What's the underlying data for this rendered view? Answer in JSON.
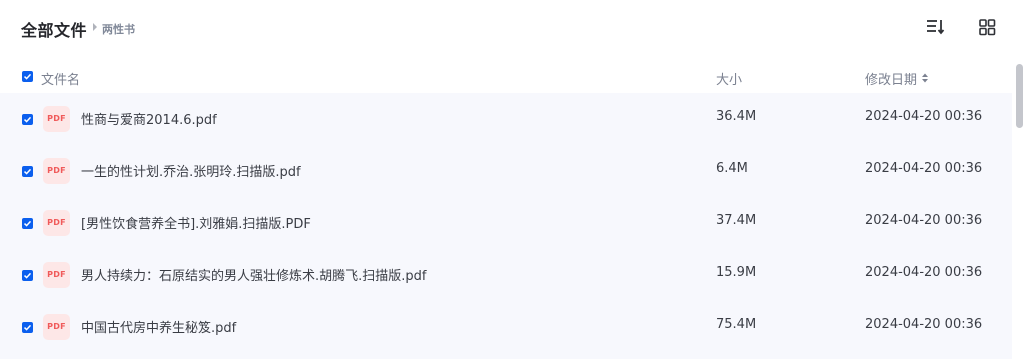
{
  "header": {
    "title": "全部文件",
    "breadcrumb": "两性书"
  },
  "toolbar": {
    "sort_icon": "sort-list-icon",
    "view_icon": "grid-view-icon"
  },
  "columns": {
    "name": "文件名",
    "size": "大小",
    "modified": "修改日期"
  },
  "files": [
    {
      "icon_label": "PDF",
      "name": "性商与爱商2014.6.pdf",
      "size": "36.4M",
      "modified": "2024-04-20 00:36",
      "checked": true
    },
    {
      "icon_label": "PDF",
      "name": "一生的性计划.乔治.张明玲.扫描版.pdf",
      "size": "6.4M",
      "modified": "2024-04-20 00:36",
      "checked": true
    },
    {
      "icon_label": "PDF",
      "name": "[男性饮食营养全书].刘雅娟.扫描版.PDF",
      "size": "37.4M",
      "modified": "2024-04-20 00:36",
      "checked": true
    },
    {
      "icon_label": "PDF",
      "name": "男人持续力：石原结实的男人强壮修炼术.胡腾飞.扫描版.pdf",
      "size": "15.9M",
      "modified": "2024-04-20 00:36",
      "checked": true
    },
    {
      "icon_label": "PDF",
      "name": "中国古代房中养生秘笈.pdf",
      "size": "75.4M",
      "modified": "2024-04-20 00:36",
      "checked": true
    }
  ],
  "colors": {
    "accent": "#0b5fee",
    "row_background": "#f7f8fd",
    "pdf_icon_bg": "#fde7e7",
    "pdf_icon_text": "#f05a5a"
  }
}
